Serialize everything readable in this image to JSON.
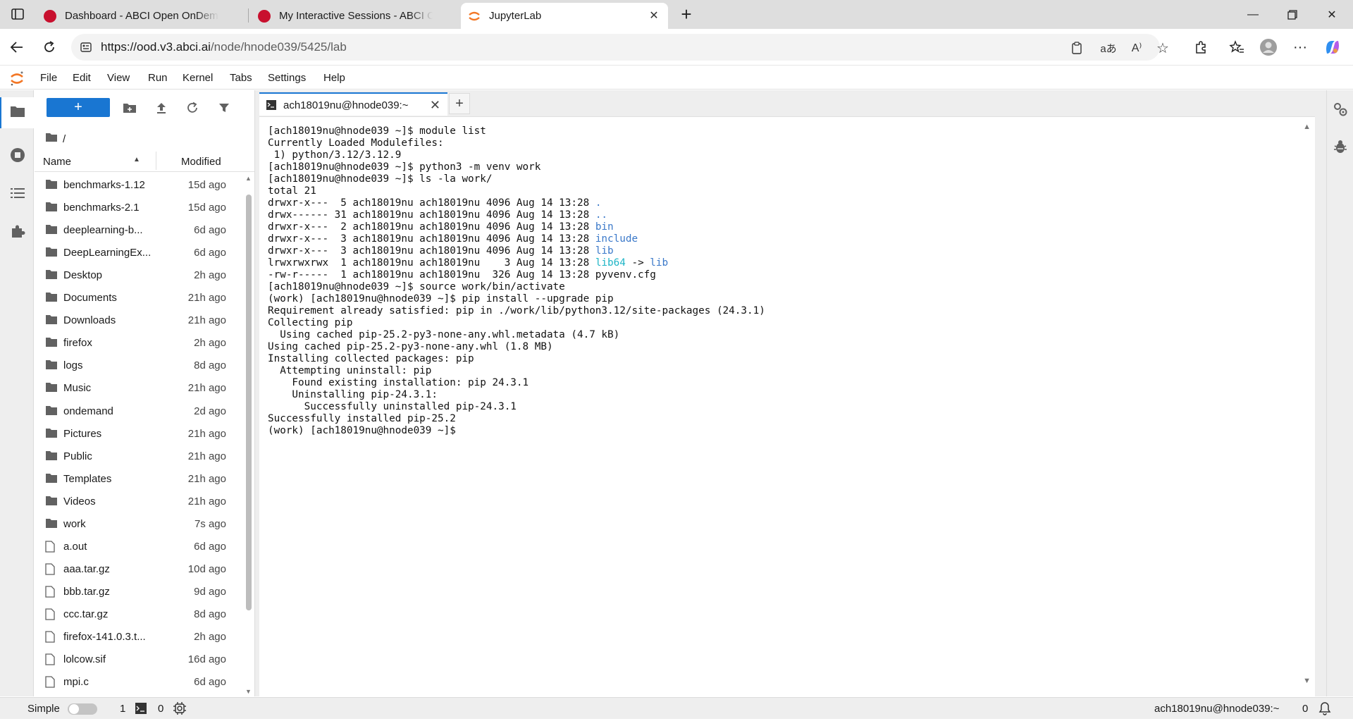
{
  "browser": {
    "tabs": [
      {
        "title": "Dashboard - ABCI Open OnDemand",
        "favicon_color": "#c8102e"
      },
      {
        "title": "My Interactive Sessions - ABCI Open OnDemand",
        "favicon_color": "#c8102e"
      },
      {
        "title": "JupyterLab",
        "favicon_color": "#f37726"
      }
    ],
    "url_host": "https://ood.v3.abci.ai",
    "url_path": "/node/hnode039/5425/lab",
    "translate_label": "aあ"
  },
  "menubar": {
    "items": [
      "File",
      "Edit",
      "View",
      "Run",
      "Kernel",
      "Tabs",
      "Settings",
      "Help"
    ]
  },
  "filebrowser": {
    "new_label": "+",
    "breadcrumb": "/",
    "col_name": "Name",
    "col_modified": "Modified",
    "files": [
      {
        "name": "benchmarks-1.12",
        "modified": "15d ago",
        "type": "folder"
      },
      {
        "name": "benchmarks-2.1",
        "modified": "15d ago",
        "type": "folder"
      },
      {
        "name": "deeplearning-b...",
        "modified": "6d ago",
        "type": "folder"
      },
      {
        "name": "DeepLearningEx...",
        "modified": "6d ago",
        "type": "folder"
      },
      {
        "name": "Desktop",
        "modified": "2h ago",
        "type": "folder"
      },
      {
        "name": "Documents",
        "modified": "21h ago",
        "type": "folder"
      },
      {
        "name": "Downloads",
        "modified": "21h ago",
        "type": "folder"
      },
      {
        "name": "firefox",
        "modified": "2h ago",
        "type": "folder"
      },
      {
        "name": "logs",
        "modified": "8d ago",
        "type": "folder"
      },
      {
        "name": "Music",
        "modified": "21h ago",
        "type": "folder"
      },
      {
        "name": "ondemand",
        "modified": "2d ago",
        "type": "folder"
      },
      {
        "name": "Pictures",
        "modified": "21h ago",
        "type": "folder"
      },
      {
        "name": "Public",
        "modified": "21h ago",
        "type": "folder"
      },
      {
        "name": "Templates",
        "modified": "21h ago",
        "type": "folder"
      },
      {
        "name": "Videos",
        "modified": "21h ago",
        "type": "folder"
      },
      {
        "name": "work",
        "modified": "7s ago",
        "type": "folder"
      },
      {
        "name": "a.out",
        "modified": "6d ago",
        "type": "file"
      },
      {
        "name": "aaa.tar.gz",
        "modified": "10d ago",
        "type": "file"
      },
      {
        "name": "bbb.tar.gz",
        "modified": "9d ago",
        "type": "file"
      },
      {
        "name": "ccc.tar.gz",
        "modified": "8d ago",
        "type": "file"
      },
      {
        "name": "firefox-141.0.3.t...",
        "modified": "2h ago",
        "type": "file"
      },
      {
        "name": "lolcow.sif",
        "modified": "16d ago",
        "type": "file"
      },
      {
        "name": "mpi.c",
        "modified": "6d ago",
        "type": "file"
      }
    ]
  },
  "terminal_tab": {
    "title": "ach18019nu@hnode039:~",
    "close": "✕",
    "add": "+"
  },
  "terminal": {
    "lines": [
      [
        {
          "t": "[ach18019nu@hnode039 ~]$ module list"
        }
      ],
      [
        {
          "t": "Currently Loaded Modulefiles:"
        }
      ],
      [
        {
          "t": " 1) python/3.12/3.12.9"
        }
      ],
      [
        {
          "t": "[ach18019nu@hnode039 ~]$ python3 -m venv work"
        }
      ],
      [
        {
          "t": "[ach18019nu@hnode039 ~]$ ls -la work/"
        }
      ],
      [
        {
          "t": "total 21"
        }
      ],
      [
        {
          "t": "drwxr-x---  5 ach18019nu ach18019nu 4096 Aug 14 13:28 "
        },
        {
          "t": ".",
          "c": "blue"
        }
      ],
      [
        {
          "t": "drwx------ 31 ach18019nu ach18019nu 4096 Aug 14 13:28 "
        },
        {
          "t": "..",
          "c": "blue"
        }
      ],
      [
        {
          "t": "drwxr-x---  2 ach18019nu ach18019nu 4096 Aug 14 13:28 "
        },
        {
          "t": "bin",
          "c": "blue"
        }
      ],
      [
        {
          "t": "drwxr-x---  3 ach18019nu ach18019nu 4096 Aug 14 13:28 "
        },
        {
          "t": "include",
          "c": "blue"
        }
      ],
      [
        {
          "t": "drwxr-x---  3 ach18019nu ach18019nu 4096 Aug 14 13:28 "
        },
        {
          "t": "lib",
          "c": "blue"
        }
      ],
      [
        {
          "t": "lrwxrwxrwx  1 ach18019nu ach18019nu    3 Aug 14 13:28 "
        },
        {
          "t": "lib64",
          "c": "cyan"
        },
        {
          "t": " -> "
        },
        {
          "t": "lib",
          "c": "blue"
        }
      ],
      [
        {
          "t": "-rw-r-----  1 ach18019nu ach18019nu  326 Aug 14 13:28 pyvenv.cfg"
        }
      ],
      [
        {
          "t": "[ach18019nu@hnode039 ~]$ source work/bin/activate"
        }
      ],
      [
        {
          "t": "(work) [ach18019nu@hnode039 ~]$ pip install --upgrade pip"
        }
      ],
      [
        {
          "t": "Requirement already satisfied: pip in ./work/lib/python3.12/site-packages (24.3.1)"
        }
      ],
      [
        {
          "t": "Collecting pip"
        }
      ],
      [
        {
          "t": "  Using cached pip-25.2-py3-none-any.whl.metadata (4.7 kB)"
        }
      ],
      [
        {
          "t": "Using cached pip-25.2-py3-none-any.whl (1.8 MB)"
        }
      ],
      [
        {
          "t": "Installing collected packages: pip"
        }
      ],
      [
        {
          "t": "  Attempting uninstall: pip"
        }
      ],
      [
        {
          "t": "    Found existing installation: pip 24.3.1"
        }
      ],
      [
        {
          "t": "    Uninstalling pip-24.3.1:"
        }
      ],
      [
        {
          "t": "      Successfully uninstalled pip-24.3.1"
        }
      ],
      [
        {
          "t": "Successfully installed pip-25.2"
        }
      ],
      [
        {
          "t": "(work) [ach18019nu@hnode039 ~]$"
        }
      ]
    ]
  },
  "statusbar": {
    "simple_label": "Simple",
    "terminals_count": "1",
    "kernels_count": "0",
    "session_label": "ach18019nu@hnode039:~",
    "notifications_count": "0"
  }
}
